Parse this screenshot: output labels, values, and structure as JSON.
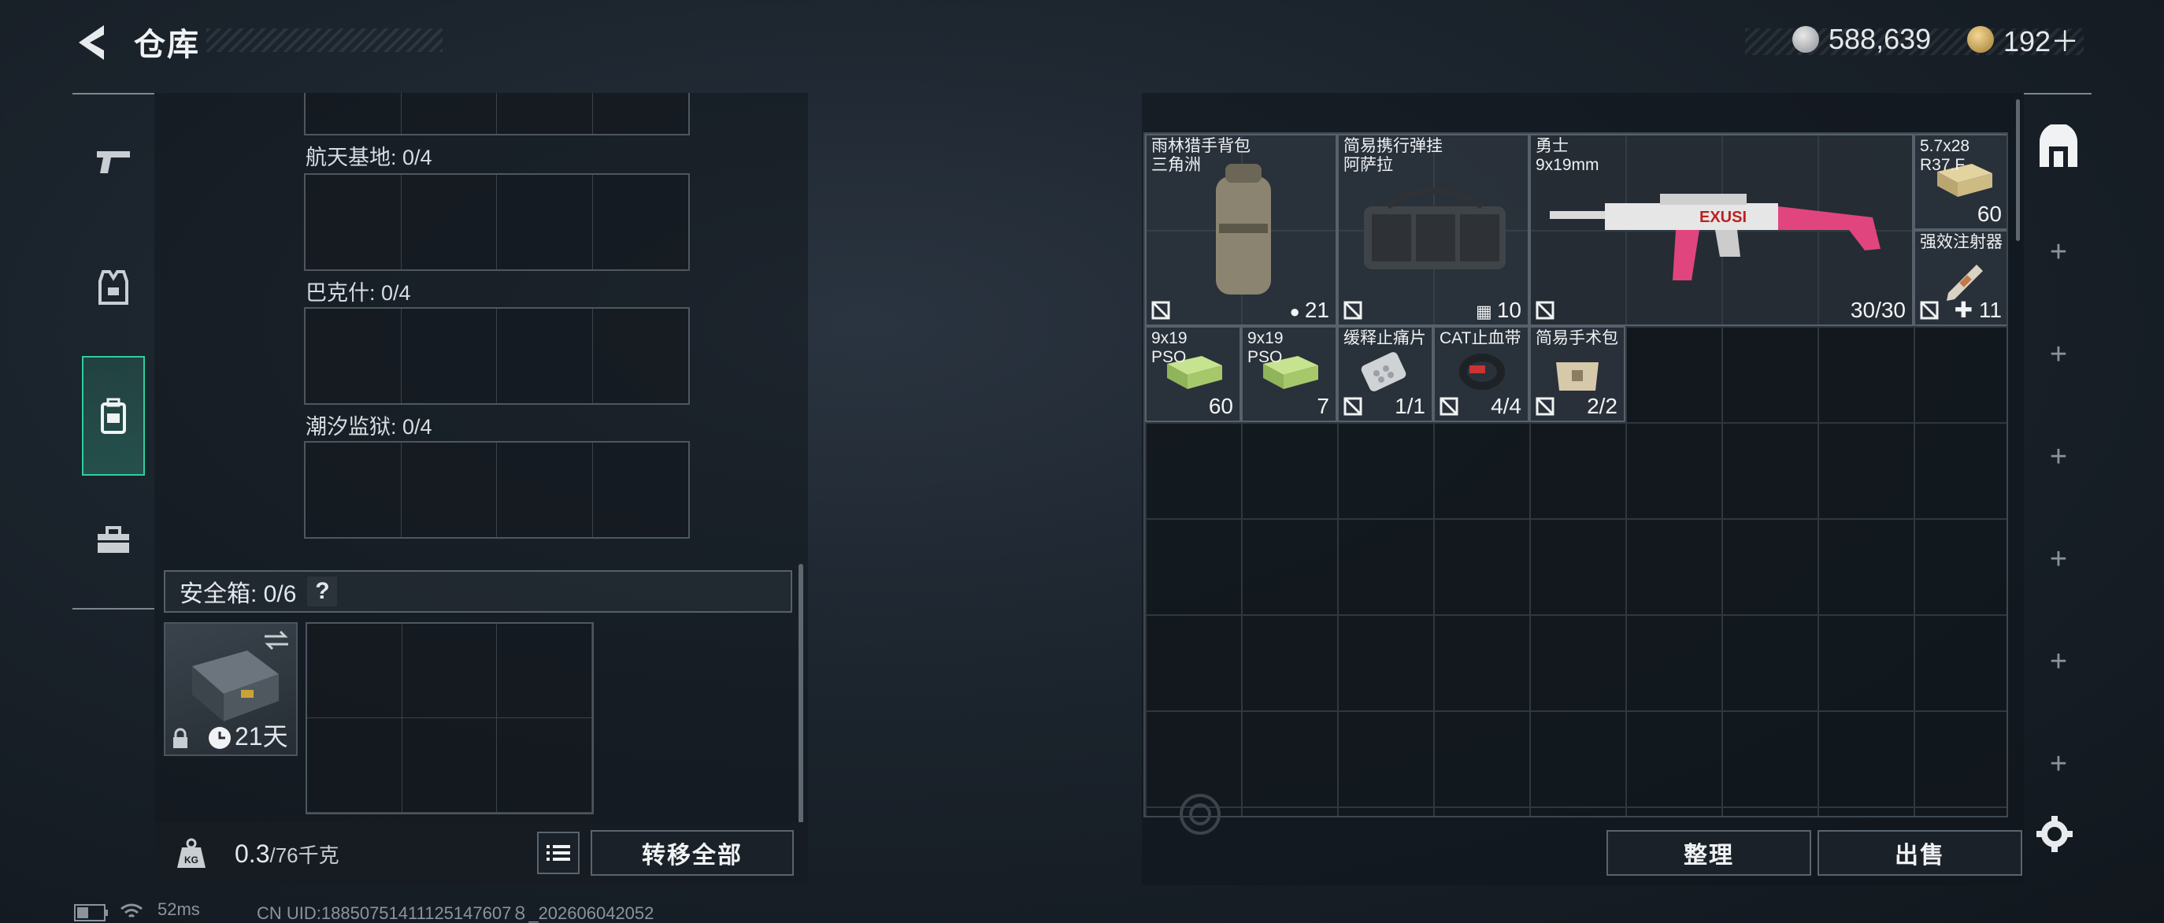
{
  "header": {
    "title": "仓库",
    "currency_silver": "588,639",
    "currency_gold": "192＋"
  },
  "sidebar": {
    "items": [
      {
        "icon": "pistol-icon"
      },
      {
        "icon": "vest-icon"
      },
      {
        "icon": "backpack-icon"
      },
      {
        "icon": "toolbox-icon"
      }
    ]
  },
  "left": {
    "sections": [
      {
        "label": "航天基地: 0/4"
      },
      {
        "label": "巴克什: 0/4"
      },
      {
        "label": "潮汐监狱: 0/4"
      }
    ],
    "safe": {
      "label": "安全箱: 0/6",
      "help": "?",
      "duration": "21天"
    },
    "weight": {
      "value": "0.3",
      "unit": "/76千克"
    },
    "transfer_all": "转移全部"
  },
  "inventory": {
    "items": [
      {
        "name": "雨林猎手背包\n三角洲",
        "count": "21"
      },
      {
        "name": "简易携行弹挂\n阿萨拉",
        "count": "10"
      },
      {
        "name": "勇士\n9x19mm",
        "count": "30/30"
      },
      {
        "name": "5.7x28\nR37.F",
        "count": "60"
      },
      {
        "name": "强效注射器",
        "count": "11"
      },
      {
        "name": "9x19\nPSO",
        "count": "60"
      },
      {
        "name": "9x19\nPSO",
        "count": "7"
      },
      {
        "name": "缓释止痛片",
        "count": "1/1"
      },
      {
        "name": "CAT止血带",
        "count": "4/4"
      },
      {
        "name": "简易手术包",
        "count": "2/2"
      }
    ],
    "sort_button": "整理",
    "sell_button": "出售"
  },
  "status": {
    "ping": "52ms",
    "uid": "CN UID:18850751411125147607８_202606042052"
  }
}
